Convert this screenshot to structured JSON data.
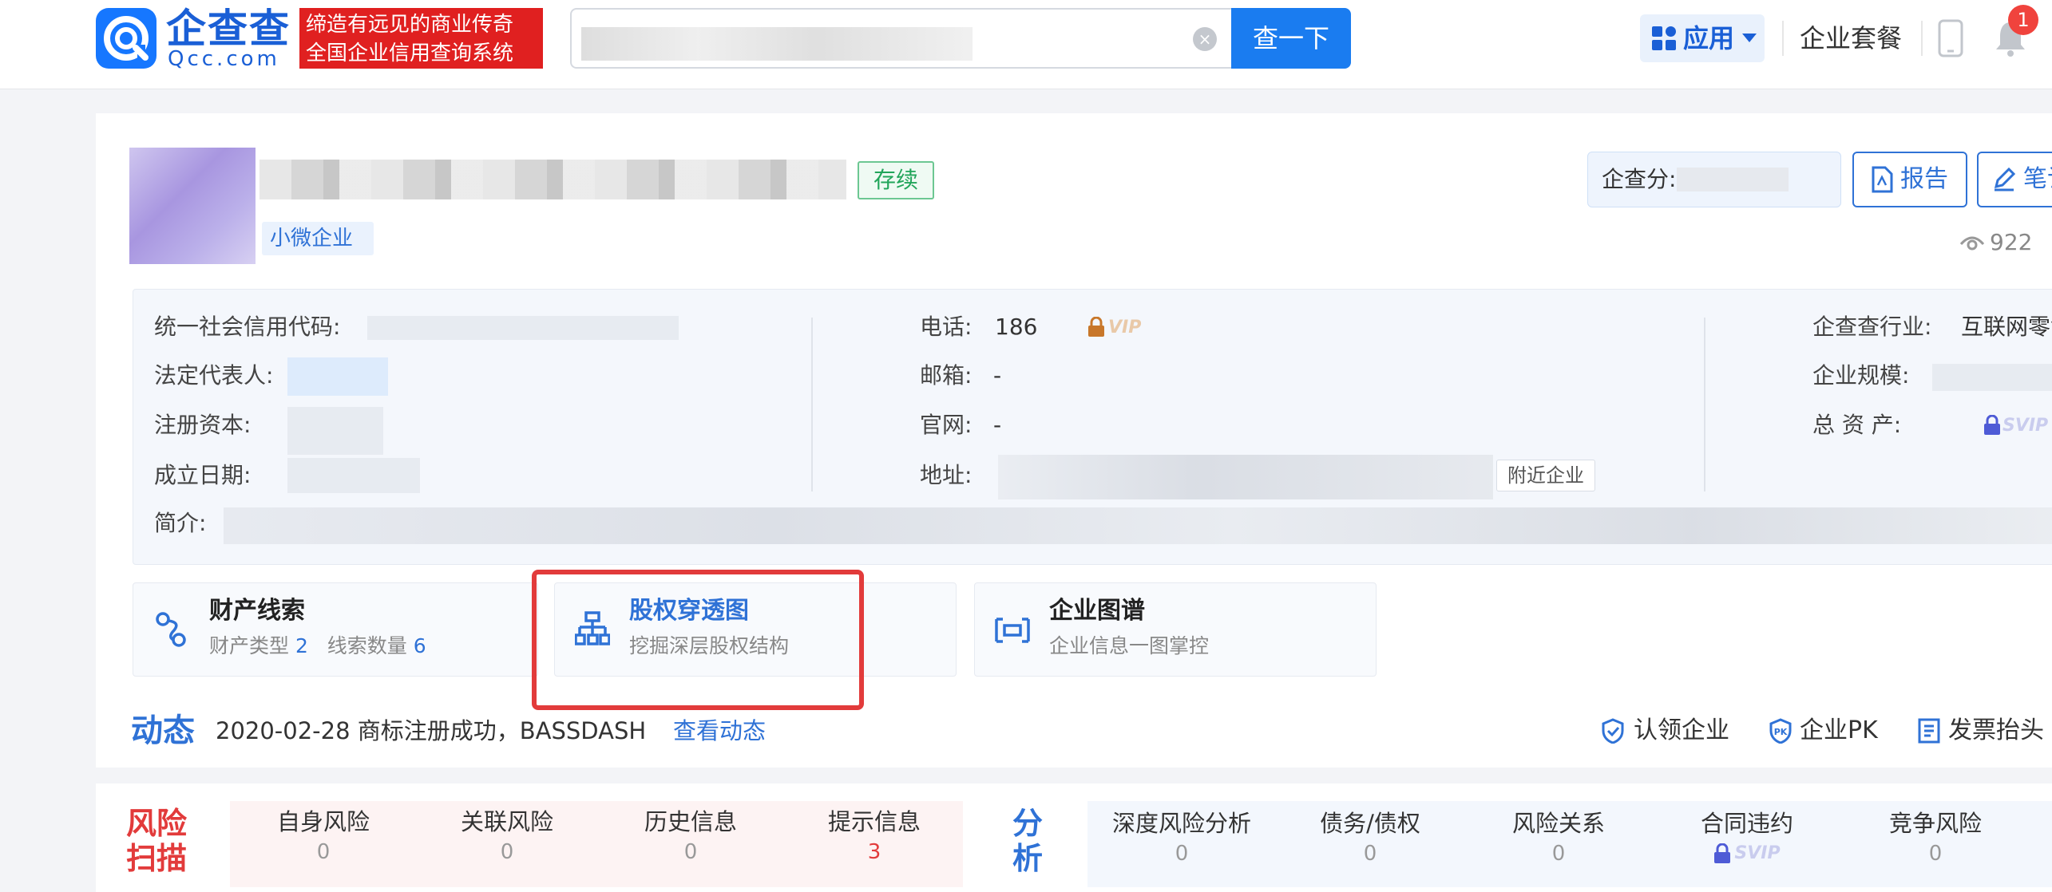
{
  "header": {
    "logo_cn": "企查查",
    "logo_en": "Qcc.com",
    "slogan_line1": "缔造有远见的商业传奇",
    "slogan_line2": "全国企业信用查询系统",
    "search_button": "查一下",
    "apps_label": "应用",
    "package_label": "企业套餐",
    "notification_count": "1"
  },
  "company": {
    "status_tag": "存续",
    "small_tag": "小微企业",
    "score_label": "企查分:",
    "report_label": "报告",
    "note_label": "笔记",
    "view_count": "922"
  },
  "info": {
    "credit_code_label": "统一社会信用代码:",
    "legal_rep_label": "法定代表人:",
    "reg_capital_label": "注册资本:",
    "founded_label": "成立日期:",
    "intro_label": "简介:",
    "phone_label": "电话:",
    "phone_value": "186",
    "email_label": "邮箱:",
    "email_value": "-",
    "website_label": "官网:",
    "website_value": "-",
    "address_label": "地址:",
    "nearby_label": "附近企业",
    "industry_label": "企查查行业:",
    "industry_value": "互联网零售",
    "scale_label": "企业规模:",
    "assets_label": "总 资 产:",
    "vip_mark": "VIP",
    "svip_mark": "SVIP"
  },
  "features": {
    "asset_title": "财产线索",
    "asset_sub1": "财产类型",
    "asset_num1": "2",
    "asset_sub2": "线索数量",
    "asset_num2": "6",
    "equity_title": "股权穿透图",
    "equity_sub": "挖掘深层股权结构",
    "graph_title": "企业图谱",
    "graph_sub": "企业信息一图掌控"
  },
  "dynamic": {
    "title": "动态",
    "text": "2020-02-28 商标注册成功，BASSDASH",
    "link": "查看动态",
    "claim": "认领企业",
    "pk": "企业PK",
    "invoice": "发票抬头"
  },
  "risk": {
    "title": "风险扫描",
    "items": [
      {
        "label": "自身风险",
        "value": "0"
      },
      {
        "label": "关联风险",
        "value": "0"
      },
      {
        "label": "历史信息",
        "value": "0"
      },
      {
        "label": "提示信息",
        "value": "3"
      }
    ]
  },
  "analysis": {
    "title": "分析",
    "items": [
      {
        "label": "深度风险分析",
        "value": "0"
      },
      {
        "label": "债务/债权",
        "value": "0"
      },
      {
        "label": "风险关系",
        "value": "0"
      },
      {
        "label": "合同违约",
        "value": ""
      },
      {
        "label": "竞争风险",
        "value": "0"
      }
    ]
  },
  "colors": {
    "brand_blue": "#1a7cf0",
    "status_green": "#22a55a",
    "risk_red": "#e23b3b",
    "link_blue": "#2f72d6"
  },
  "icons": [
    "qcc-logo-icon",
    "search-clear-icon",
    "apps-grid-icon",
    "caret-down-icon",
    "phone-device-icon",
    "bell-icon",
    "report-pdf-icon",
    "edit-pen-icon",
    "eye-icon",
    "lock-icon",
    "asset-clue-icon",
    "equity-structure-icon",
    "company-graph-icon",
    "claim-shield-icon",
    "pk-shield-icon",
    "invoice-icon"
  ]
}
